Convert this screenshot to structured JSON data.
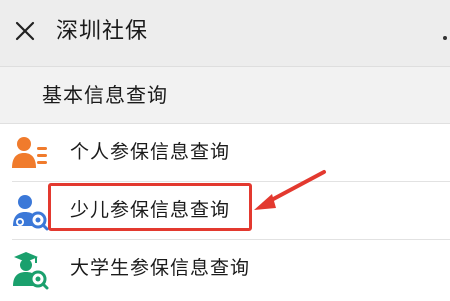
{
  "topbar": {
    "title": "深圳社保",
    "close_icon": "close-icon"
  },
  "section": {
    "title": "基本信息查询"
  },
  "items": [
    {
      "label": "个人参保信息查询",
      "icon": "person-card-icon",
      "color": "#f07b2c"
    },
    {
      "label": "少儿参保信息查询",
      "icon": "child-search-icon",
      "color": "#3b78d8"
    },
    {
      "label": "大学生参保信息查询",
      "icon": "graduate-search-icon",
      "color": "#1aa06d"
    }
  ],
  "annotation": {
    "highlight_color": "#e3392f",
    "highlighted_item": "少儿参保信息查询"
  }
}
